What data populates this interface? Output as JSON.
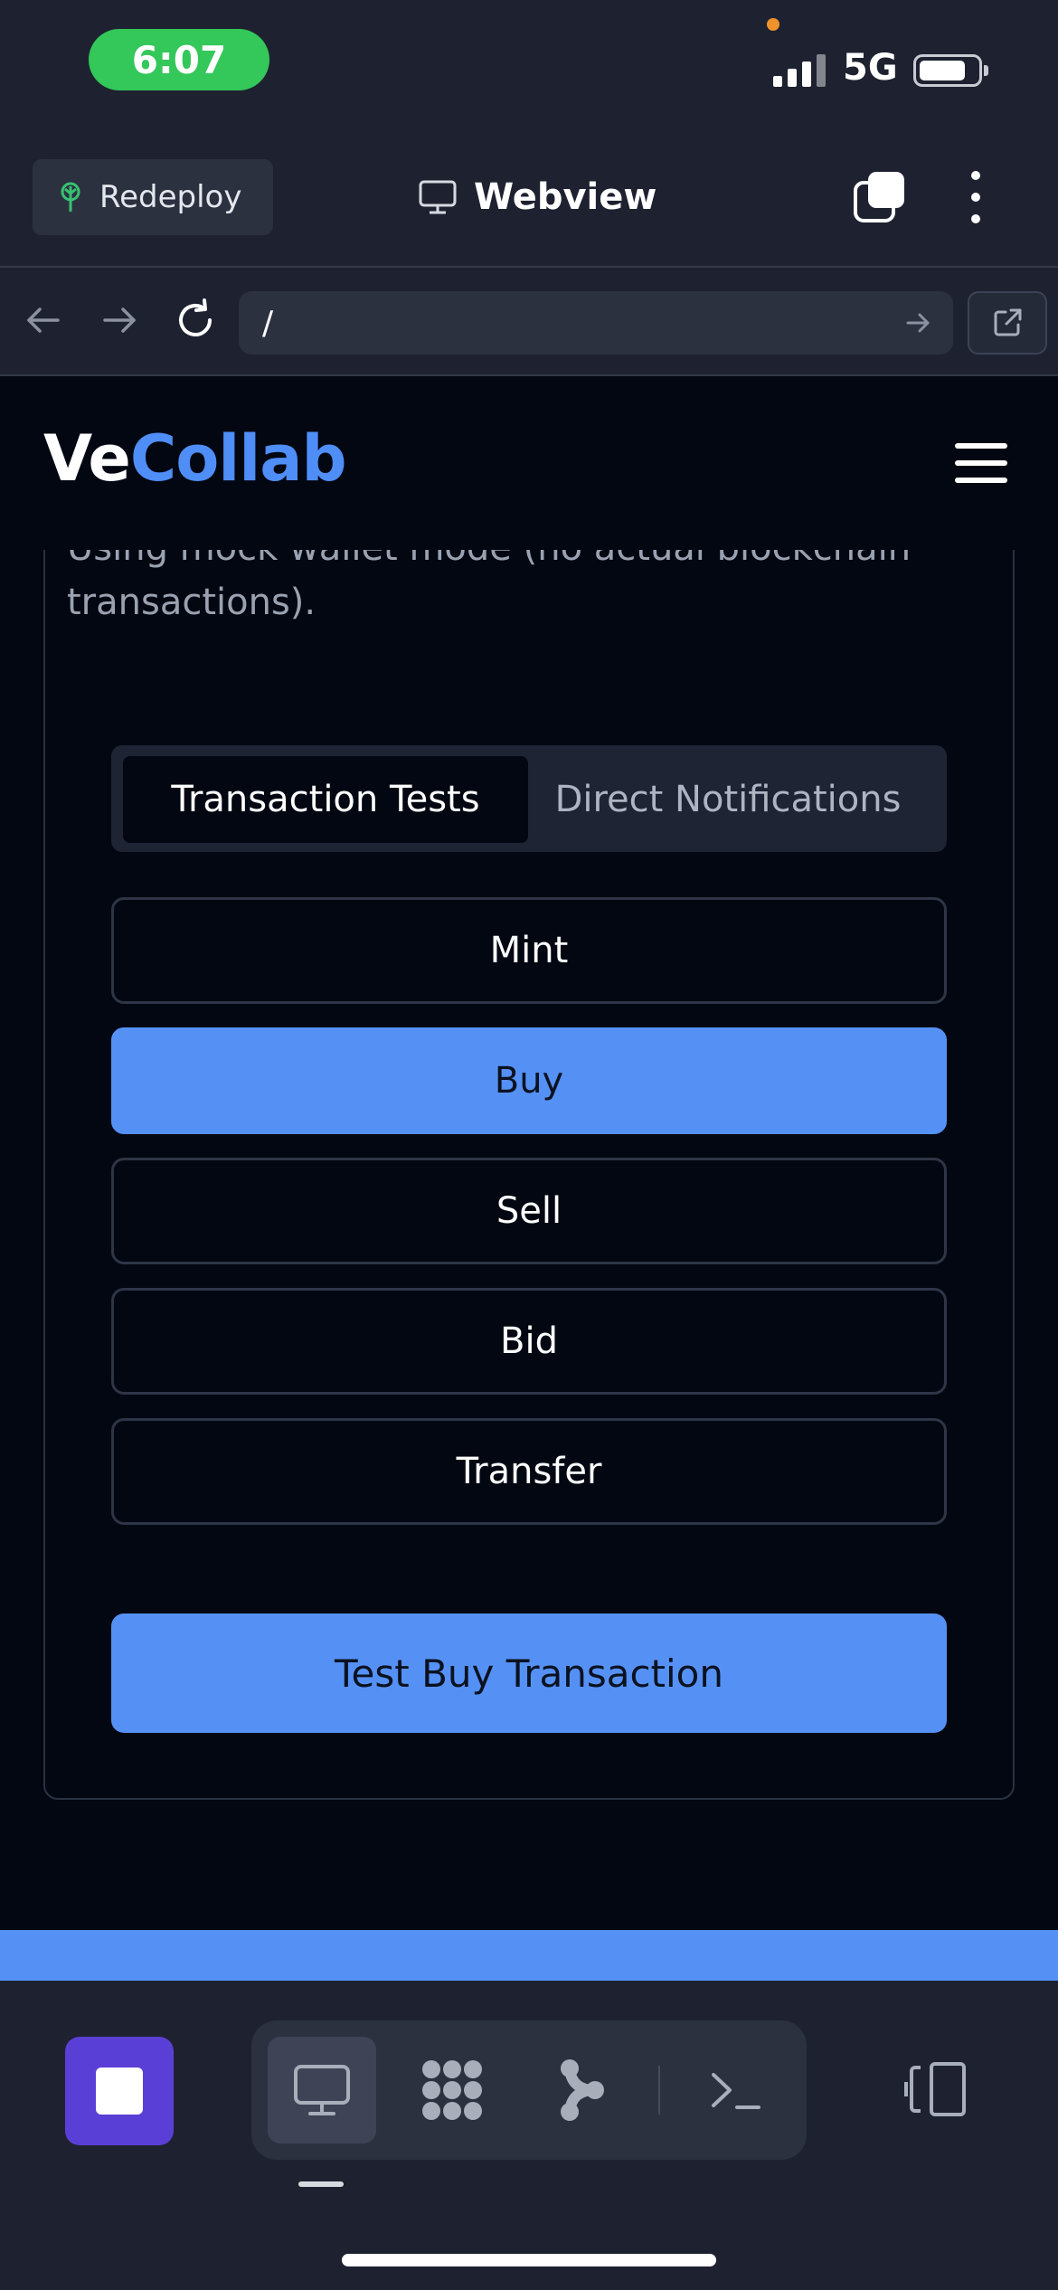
{
  "status_bar": {
    "time": "6:07",
    "network": "5G"
  },
  "header": {
    "redeploy_label": "Redeploy",
    "title": "Webview"
  },
  "url_bar": {
    "url": "/"
  },
  "site": {
    "logo_part1": "Ve",
    "logo_part2": "Collab",
    "description": "transaction simulations and direct notifications. Using mock wallet mode (no actual blockchain transactions).",
    "tabs": [
      {
        "label": "Transaction Tests",
        "active": true
      },
      {
        "label": "Direct Notifications",
        "active": false
      }
    ],
    "transaction_types": [
      {
        "label": "Mint",
        "selected": false
      },
      {
        "label": "Buy",
        "selected": true
      },
      {
        "label": "Sell",
        "selected": false
      },
      {
        "label": "Bid",
        "selected": false
      },
      {
        "label": "Transfer",
        "selected": false
      }
    ],
    "submit_label": "Test Buy Transaction"
  },
  "toolbar": {
    "tools": [
      "webview-icon",
      "packages-icon",
      "git-icon",
      "terminal-icon"
    ],
    "active_tool": "webview-icon"
  },
  "colors": {
    "accent": "#5591f5",
    "logo_blue": "#4f8ef7",
    "stop_button": "#5a3fd6",
    "time_pill": "#34c759"
  }
}
